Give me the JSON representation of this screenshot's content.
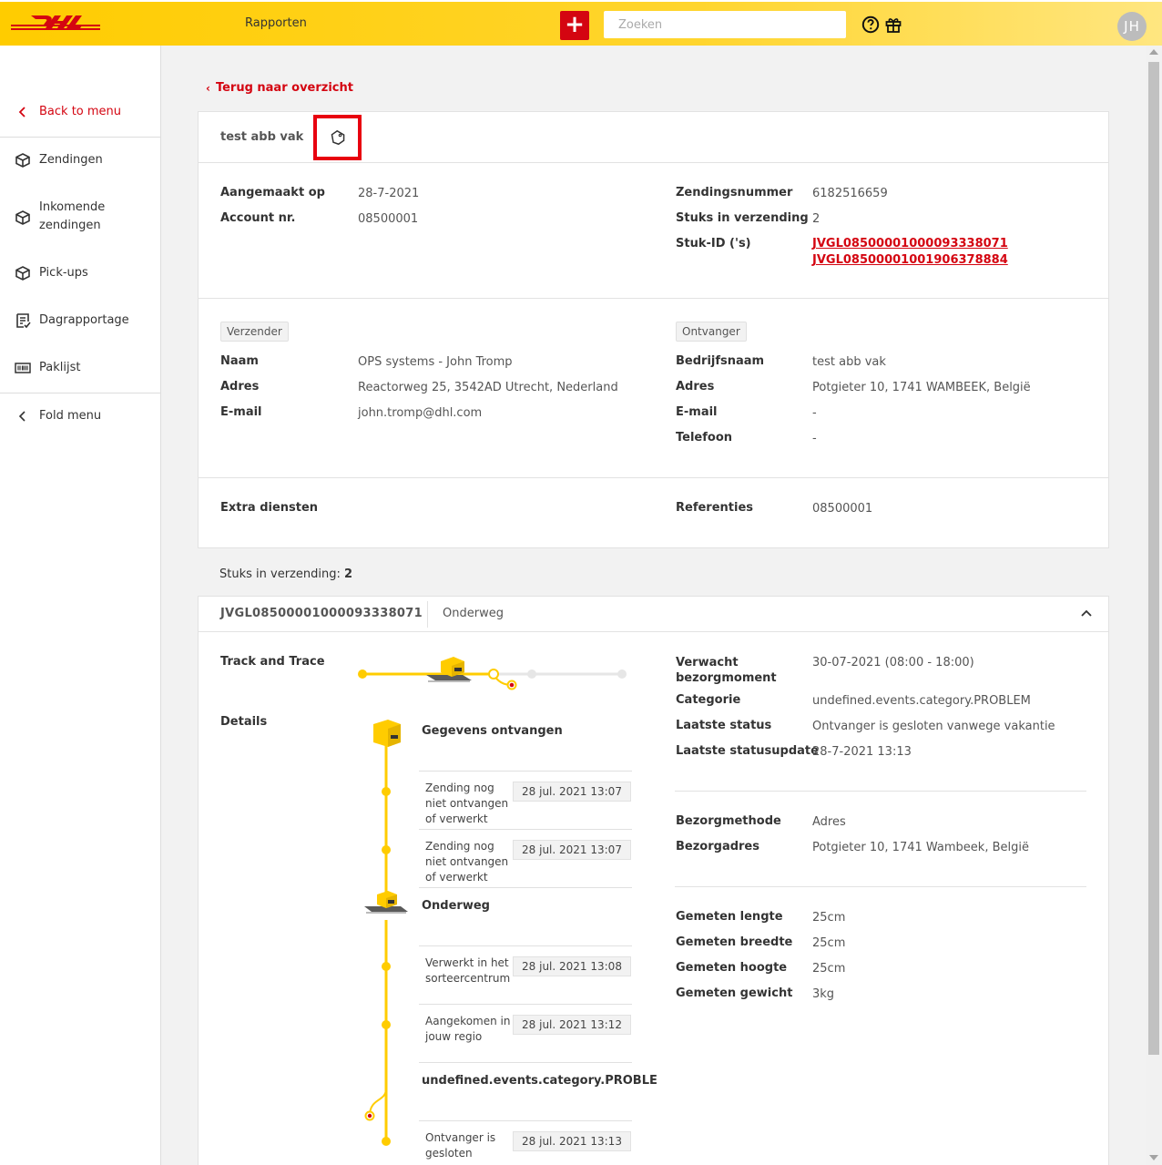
{
  "header": {
    "nav_label": "Rapporten",
    "plus_label": "+",
    "search_placeholder": "Zoeken",
    "avatar_initials": "JH",
    "brand_color": "#ffcc00",
    "accent_color": "#d40511"
  },
  "sidebar": {
    "back_label": "Back to menu",
    "items": [
      {
        "label": "Zendingen",
        "icon": "package-icon"
      },
      {
        "label": "Inkomende zendingen",
        "icon": "package-icon"
      },
      {
        "label": "Pick-ups",
        "icon": "package-icon"
      },
      {
        "label": "Dagrapportage",
        "icon": "report-icon"
      },
      {
        "label": "Paklijst",
        "icon": "barcode-icon"
      }
    ],
    "fold_label": "Fold menu"
  },
  "main": {
    "back_link": "Terug naar overzicht",
    "card_title": "test abb vak",
    "info": {
      "aangemaakt_label": "Aangemaakt op",
      "aangemaakt_value": "28-7-2021",
      "account_label": "Account nr.",
      "account_value": "08500001",
      "zendingsnummer_label": "Zendingsnummer",
      "zendingsnummer_value": "6182516659",
      "stuks_label": "Stuks in verzending",
      "stuks_value": "2",
      "stukid_label": "Stuk-ID ('s)",
      "stukid_values": [
        "JVGL08500001000093338071",
        "JVGL08500001001906378884"
      ]
    },
    "sender": {
      "pill": "Verzender",
      "naam_label": "Naam",
      "naam_value": "OPS systems - John Tromp",
      "adres_label": "Adres",
      "adres_value": "Reactorweg 25, 3542AD Utrecht, Nederland",
      "email_label": "E-mail",
      "email_value": "john.tromp@dhl.com"
    },
    "receiver": {
      "pill": "Ontvanger",
      "bedrijf_label": "Bedrijfsnaam",
      "bedrijf_value": "test abb vak",
      "adres_label": "Adres",
      "adres_value": "Potgieter 10, 1741 WAMBEEK, België",
      "email_label": "E-mail",
      "email_value": "-",
      "telefoon_label": "Telefoon",
      "telefoon_value": "-"
    },
    "extra": {
      "extra_label": "Extra diensten",
      "ref_label": "Referenties",
      "ref_value": "08500001"
    },
    "stuks_line_label": "Stuks in verzending:",
    "stuks_line_value": "2"
  },
  "piece": {
    "id": "JVGL08500001000093338071",
    "status": "Onderweg",
    "track_label": "Track and Trace",
    "details_label": "Details",
    "events": [
      {
        "type": "title",
        "text": "Gegevens ontvangen"
      },
      {
        "type": "row",
        "desc": "Zending nog niet ontvangen of verwerkt",
        "time": "28 jul. 2021 13:07"
      },
      {
        "type": "row",
        "desc": "Zending nog niet ontvangen of verwerkt",
        "time": "28 jul. 2021 13:07"
      },
      {
        "type": "title",
        "text": "Onderweg"
      },
      {
        "type": "row",
        "desc": "Verwerkt in het sorteercentrum",
        "time": "28 jul. 2021 13:08"
      },
      {
        "type": "row",
        "desc": "Aangekomen in jouw regio",
        "time": "28 jul. 2021 13:12"
      },
      {
        "type": "title",
        "text": "undefined.events.category.PROBLE"
      },
      {
        "type": "row",
        "desc": "Ontvanger is gesloten",
        "time": "28 jul. 2021 13:13"
      }
    ],
    "right": {
      "verwacht_label": "Verwacht bezorgmoment",
      "verwacht_value": "30-07-2021 (08:00 - 18:00)",
      "categorie_label": "Categorie",
      "categorie_value": "undefined.events.category.PROBLEM",
      "laatste_status_label": "Laatste status",
      "laatste_status_value": "Ontvanger is gesloten vanwege vakantie",
      "laatste_update_label": "Laatste statusupdate",
      "laatste_update_value": "28-7-2021 13:13",
      "bezorgmethode_label": "Bezorgmethode",
      "bezorgmethode_value": "Adres",
      "bezorgadres_label": "Bezorgadres",
      "bezorgadres_value": "Potgieter 10, 1741 Wambeek, België",
      "lengte_label": "Gemeten lengte",
      "lengte_value": "25cm",
      "breedte_label": "Gemeten breedte",
      "breedte_value": "25cm",
      "hoogte_label": "Gemeten hoogte",
      "hoogte_value": "25cm",
      "gewicht_label": "Gemeten gewicht",
      "gewicht_value": "3kg"
    }
  }
}
